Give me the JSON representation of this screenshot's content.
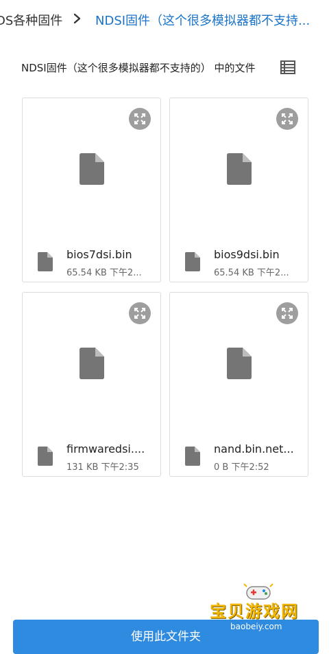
{
  "breadcrumb": {
    "previous": "DS各种固件",
    "current": "NDSI固件（这个很多模拟器都不支持..."
  },
  "folder_label": "NDSI固件（这个很多模拟器都不支持的） 中的文件",
  "files": [
    {
      "name": "bios7dsi.bin",
      "meta": "65.54 KB 下午2..."
    },
    {
      "name": "bios9dsi.bin",
      "meta": "65.54 KB 下午2..."
    },
    {
      "name": "firmwaredsi....",
      "meta": "131 KB 下午2:35"
    },
    {
      "name": "nand.bin.net...",
      "meta": "0 B 下午2:52"
    }
  ],
  "button": {
    "use_folder": "使用此文件夹"
  },
  "watermark": {
    "title": "宝贝游戏网",
    "url": "baobeiy.com"
  },
  "colors": {
    "accent": "#2e8be0",
    "link": "#1a73c8",
    "icon_gray": "#757575"
  },
  "icons": [
    "chevron-right-icon",
    "list-view-icon",
    "expand-icon",
    "file-icon"
  ]
}
